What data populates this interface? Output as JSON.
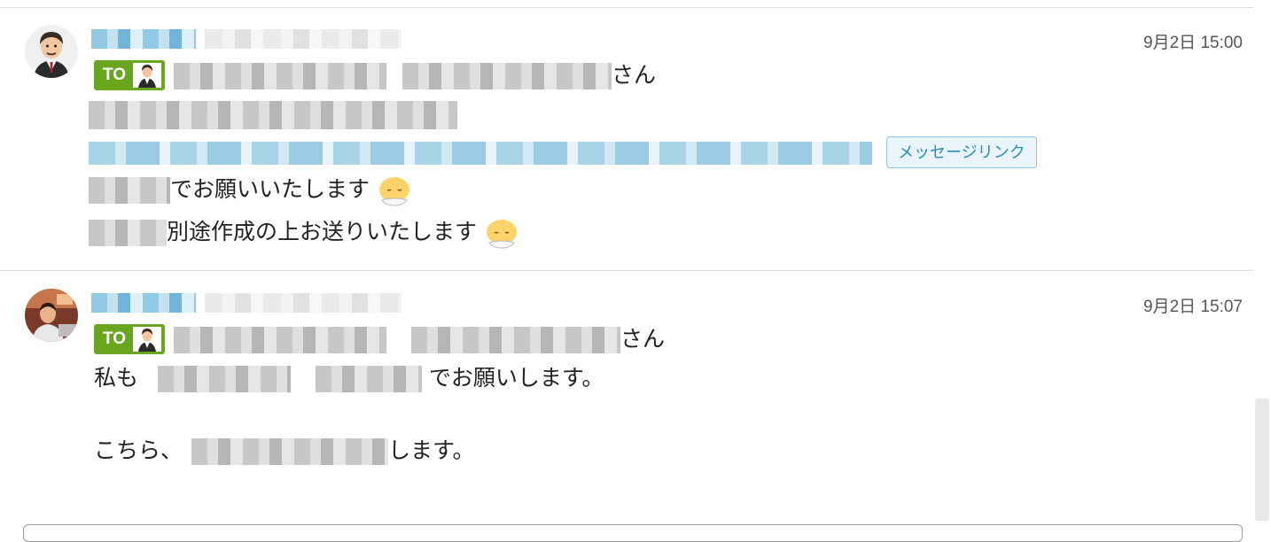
{
  "messages": [
    {
      "time": "9月2日 15:00",
      "to_label": "TO",
      "san": "さん",
      "line3_text": "でお願いいたします",
      "line4_text": "別途作成の上お送りいたします",
      "message_link_label": "メッセージリンク"
    },
    {
      "time": "9月2日 15:07",
      "to_label": "TO",
      "san": "さん",
      "line2_prefix": "私も",
      "line2_suffix": "でお願いします。",
      "line3_prefix": "こちら、",
      "line3_suffix": "します。"
    }
  ],
  "icons": [
    "avatar",
    "to-avatar-icon",
    "bowing-emoji-icon"
  ]
}
